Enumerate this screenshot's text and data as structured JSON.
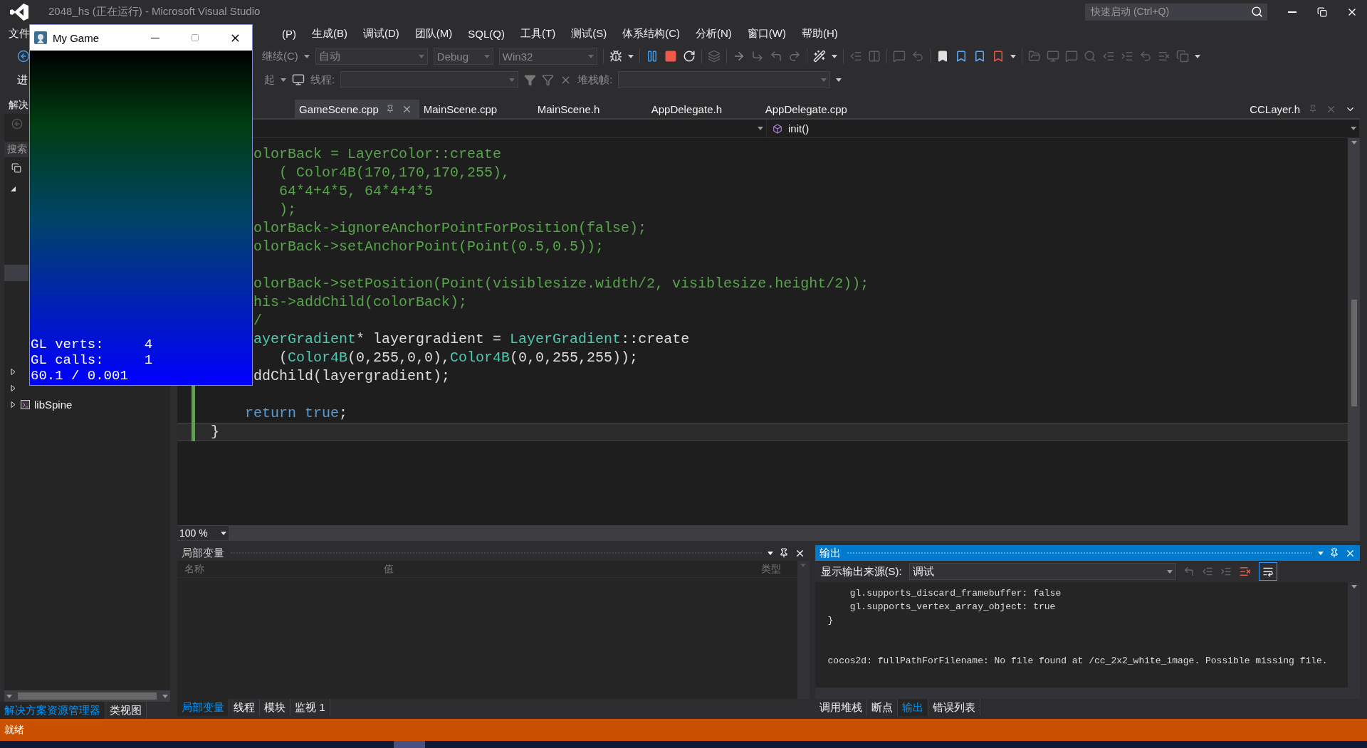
{
  "window": {
    "title": "2048_hs (正在运行) - Microsoft Visual Studio"
  },
  "quick_launch": {
    "placeholder": "快速启动 (Ctrl+Q)"
  },
  "menu_left": [
    "文件"
  ],
  "menu": [
    "(P)",
    "生成(B)",
    "调试(D)",
    "团队(M)",
    "SQL(Q)",
    "工具(T)",
    "测试(S)",
    "体系结构(C)",
    "分析(N)",
    "窗口(W)",
    "帮助(H)"
  ],
  "debug_toolbar": {
    "continue": "继续(C)",
    "dropdowns": [
      "自动",
      "Debug",
      "Win32"
    ]
  },
  "location_toolbar": {
    "left_text": "进",
    "suspend": "起",
    "thread_label": "线程:",
    "stack_label": "堆栈帧:"
  },
  "solution_explorer": {
    "title": "解决",
    "search": {
      "placeholder": "搜索"
    },
    "tree": [
      {
        "expanded": true,
        "selected": false,
        "children": [
          {
            "selected": true
          },
          {
            "expanded": false,
            "selected": false
          },
          {
            "expanded": false,
            "selected": false
          },
          {
            "label": "libSpine",
            "expanded": false,
            "selected": false
          }
        ]
      }
    ],
    "tabs": [
      {
        "label": "解决方案资源管理器",
        "selected": true
      },
      {
        "label": "类视图",
        "selected": false
      }
    ]
  },
  "editor": {
    "tabs": [
      {
        "label": "GameScene.cpp",
        "selected": true
      },
      {
        "label": "MainScene.cpp",
        "selected": false
      },
      {
        "label": "MainScene.h",
        "selected": false
      },
      {
        "label": "AppDelegate.h",
        "selected": false
      },
      {
        "label": "AppDelegate.cpp",
        "selected": false
      }
    ],
    "preview_tab": {
      "label": "CCLayer.h"
    },
    "member": "init()",
    "lines": [
      {
        "kind": "code",
        "parts": [
          {
            "text": "     olorBack = LayerColor::create",
            "kind": "comment"
          }
        ]
      },
      {
        "kind": "code",
        "parts": [
          {
            "text": "        ( Color4B(170,170,170,255),",
            "kind": "comment"
          }
        ]
      },
      {
        "kind": "code",
        "parts": [
          {
            "text": "        64*4+4*5, 64*4+4*5",
            "kind": "comment"
          }
        ]
      },
      {
        "kind": "code",
        "parts": [
          {
            "text": "        );",
            "kind": "comment"
          }
        ]
      },
      {
        "kind": "code",
        "parts": [
          {
            "text": "     olorBack->ignoreAnchorPointForPosition(false);",
            "kind": "comment"
          }
        ]
      },
      {
        "kind": "code",
        "parts": [
          {
            "text": "     olorBack->setAnchorPoint(Point(0.5,0.5));",
            "kind": "comment"
          }
        ]
      },
      {
        "kind": "blank"
      },
      {
        "kind": "code",
        "parts": [
          {
            "text": "     olorBack->setPosition(Point(visiblesize.width/2, visiblesize.height/2));",
            "kind": "comment"
          }
        ]
      },
      {
        "kind": "code",
        "parts": [
          {
            "text": "     his->addChild(colorBack);",
            "kind": "comment"
          }
        ]
      },
      {
        "kind": "code",
        "parts": [
          {
            "text": "     /",
            "kind": "comment"
          }
        ]
      },
      {
        "kind": "code",
        "parts": [
          {
            "text": "     ayerGradient",
            "kind": "type"
          },
          {
            "text": "* layergradient = ",
            "kind": "plain"
          },
          {
            "text": "LayerGradient",
            "kind": "type"
          },
          {
            "text": "::create",
            "kind": "plain"
          }
        ]
      },
      {
        "kind": "code",
        "parts": [
          {
            "text": "        (",
            "kind": "plain"
          },
          {
            "text": "Color4B",
            "kind": "type"
          },
          {
            "text": "(0,255,0,0),",
            "kind": "plain"
          },
          {
            "text": "Color4B",
            "kind": "type"
          },
          {
            "text": "(0,0,255,255));",
            "kind": "plain"
          }
        ]
      },
      {
        "kind": "code",
        "parts": [
          {
            "text": "     ddChild(layergradient);",
            "kind": "plain"
          }
        ]
      }
    ],
    "lines_below": [
      {
        "kind": "blank",
        "changed": true,
        "current": false
      },
      {
        "kind": "code",
        "changed": true,
        "current": false,
        "parts": [
          {
            "text": "    return",
            "kind": "keyword"
          },
          {
            "text": " true",
            "kind": "keyword"
          },
          {
            "text": ";",
            "kind": "plain"
          }
        ]
      },
      {
        "kind": "code",
        "changed": true,
        "current": true,
        "parts": [
          {
            "text": "}",
            "kind": "plain"
          }
        ]
      }
    ],
    "zoom": "100 %"
  },
  "locals": {
    "title": "局部变量",
    "active": false,
    "columns": [
      "名称",
      "值",
      "类型"
    ],
    "tabs": [
      {
        "label": "局部变量",
        "selected": true
      },
      {
        "label": "线程",
        "selected": false
      },
      {
        "label": "模块",
        "selected": false
      },
      {
        "label": "监视 1",
        "selected": false
      }
    ]
  },
  "output": {
    "title": "输出",
    "active": true,
    "source_label": "显示输出来源(S):",
    "source": "调试",
    "wrap_on": true,
    "lines": [
      "    gl.supports_discard_framebuffer: false",
      "    gl.supports_vertex_array_object: true",
      "}"
    ],
    "trailing_lines": [
      "cocos2d: fullPathForFilename: No file found at /cc_2x2_white_image. Possible missing file."
    ],
    "tabs": [
      {
        "label": "调用堆栈",
        "selected": false
      },
      {
        "label": "断点",
        "selected": false
      },
      {
        "label": "输出",
        "selected": true
      },
      {
        "label": "错误列表",
        "selected": false
      }
    ]
  },
  "game_window": {
    "title": "My Game",
    "stats": [
      "GL verts:     4",
      "GL calls:     1",
      "60.1 / 0.001"
    ]
  },
  "status": "就绪"
}
